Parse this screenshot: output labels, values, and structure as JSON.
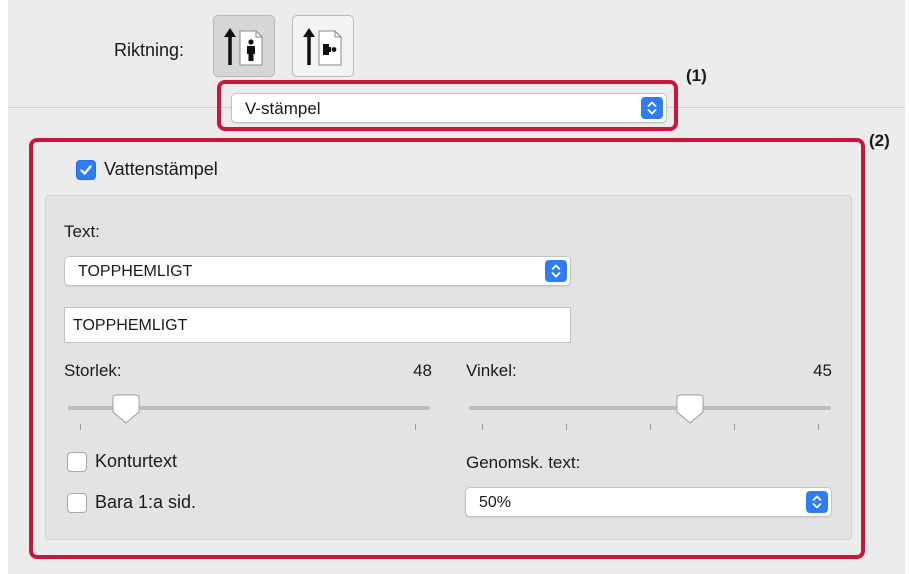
{
  "orientation": {
    "label": "Riktning:",
    "options": [
      "portrait-icon",
      "landscape-icon"
    ],
    "selected": "portrait-icon"
  },
  "callouts": {
    "one": "(1)",
    "two": "(2)"
  },
  "stamp_select": {
    "value": "V-stämpel"
  },
  "watermark": {
    "checkbox_label": "Vattenstämpel",
    "checked": true,
    "text_label": "Text:",
    "text_select_value": "TOPPHEMLIGT",
    "text_field_value": "TOPPHEMLIGT",
    "size": {
      "label": "Storlek:",
      "value": "48",
      "position": 0.16
    },
    "angle": {
      "label": "Vinkel:",
      "value": "45",
      "position": 0.61
    },
    "outline": {
      "label": "Konturtext",
      "checked": false
    },
    "first_page": {
      "label": "Bara 1:a sid.",
      "checked": false
    },
    "opacity": {
      "label": "Genomsk. text:",
      "value": "50%"
    }
  },
  "colors": {
    "accent": "#2f7df6",
    "callout": "#c8183a",
    "panel": "#ececec"
  }
}
